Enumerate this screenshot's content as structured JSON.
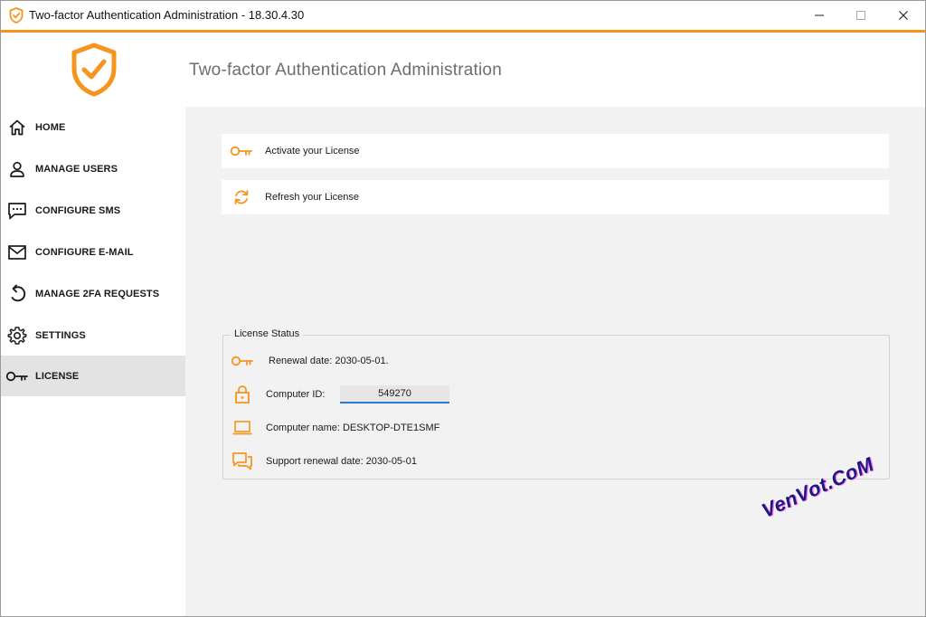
{
  "window": {
    "title": "Two-factor Authentication Administration - 18.30.4.30",
    "accent_color": "#f7941d"
  },
  "header": {
    "title": "Two-factor Authentication Administration",
    "logo_icon": "shield-check-icon"
  },
  "sidebar": {
    "items": [
      {
        "label": "HOME",
        "icon": "home-icon",
        "active": false
      },
      {
        "label": "MANAGE USERS",
        "icon": "user-icon",
        "active": false
      },
      {
        "label": "CONFIGURE SMS",
        "icon": "chat-icon",
        "active": false
      },
      {
        "label": "CONFIGURE E-MAIL",
        "icon": "envelope-icon",
        "active": false
      },
      {
        "label": "MANAGE 2FA REQUESTS",
        "icon": "undo-icon",
        "active": false
      },
      {
        "label": "SETTINGS",
        "icon": "gear-icon",
        "active": false
      },
      {
        "label": "LICENSE",
        "icon": "key-icon",
        "active": true
      }
    ]
  },
  "actions": [
    {
      "label": "Activate your License",
      "icon": "key-icon"
    },
    {
      "label": "Refresh your License",
      "icon": "refresh-icon"
    }
  ],
  "license_status": {
    "legend": "License Status",
    "renewal_date_text": "Renewal date: 2030-05-01.",
    "computer_id_label": "Computer ID:",
    "computer_id_value": "549270",
    "computer_name_text": "Computer name: DESKTOP-DTE1SMF",
    "support_renewal_text": "Support renewal date: 2030-05-01"
  },
  "watermark": "VenVot.CoM"
}
